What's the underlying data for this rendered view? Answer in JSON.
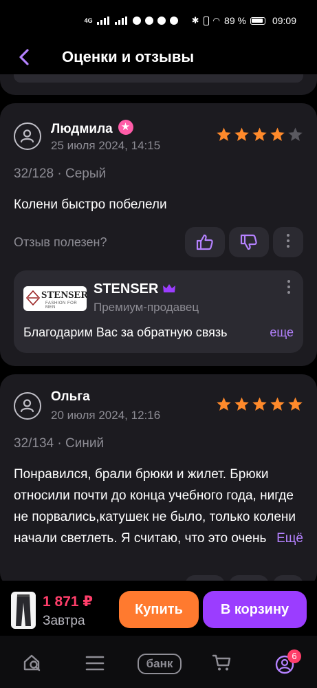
{
  "status": {
    "network": "4G",
    "battery": "89 %",
    "time": "09:09"
  },
  "header": {
    "title": "Оценки и отзывы"
  },
  "reviews": [
    {
      "name": "Людмила",
      "date": "25 июля 2024, 14:15",
      "rating": 4,
      "meta": "32/128 · Серый",
      "text": "Колени быстро побелели",
      "helpful_label": "Отзыв полезен?",
      "seller": {
        "name": "STENSER",
        "logo_text": "STENSER",
        "logo_sub": "FASHION FOR MEN",
        "subtitle": "Премиум-продавец",
        "reply": "Благодарим Вас за обратную связь",
        "more": "еще"
      }
    },
    {
      "name": "Ольга",
      "date": "20 июля 2024, 12:16",
      "rating": 5,
      "meta": "32/134 · Синий",
      "text": "Понравился, брали брюки и жилет. Брюки относили почти до конца учебного года, нигде не порвались,катушек не было, только колени начали светлеть. Я считаю, что это очень хорошо, т.к. брюк други",
      "more": "Ещё"
    }
  ],
  "buybar": {
    "price": "1 871 ₽",
    "delivery": "Завтра",
    "buy_label": "Купить",
    "cart_label": "В корзину"
  },
  "nav": {
    "bank_label": "банк",
    "profile_badge": "6"
  },
  "colors": {
    "accent": "#9b3dff",
    "buy": "#ff7a2f",
    "star": "#ff8a2b",
    "price": "#ff3e6a",
    "card": "#1c1b20"
  }
}
